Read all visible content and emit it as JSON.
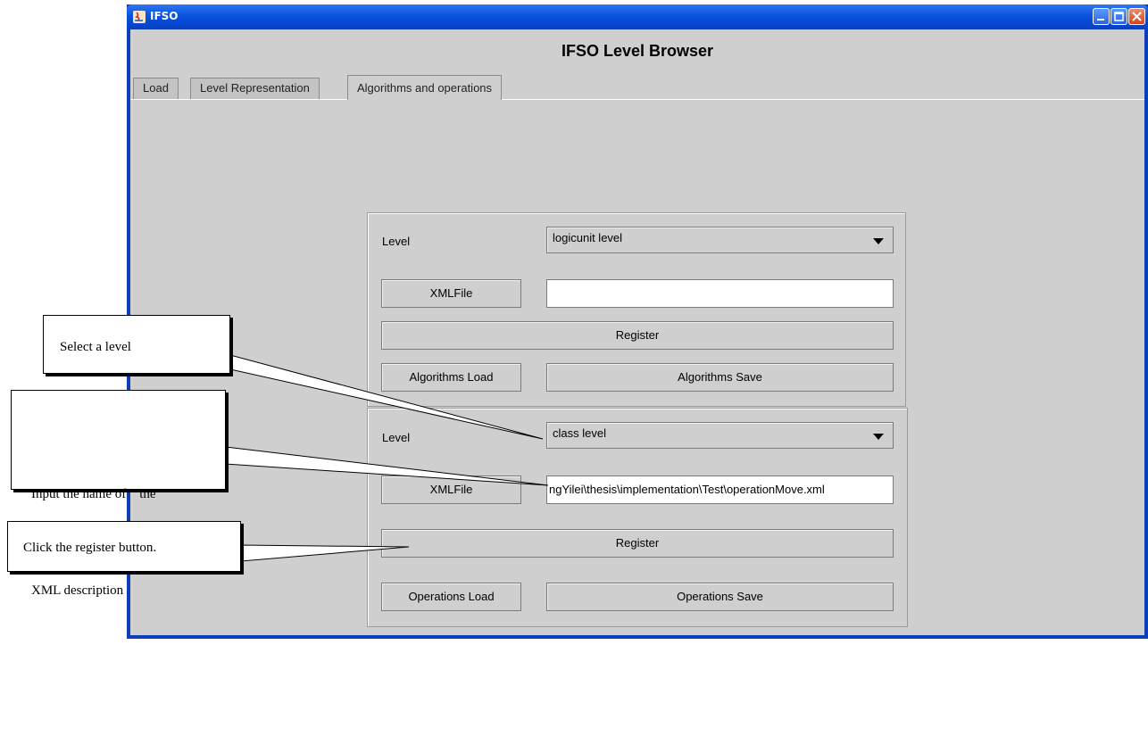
{
  "window": {
    "title": "IFSO"
  },
  "app": {
    "heading": "IFSO Level Browser"
  },
  "tabs": [
    {
      "label": "Load"
    },
    {
      "label": "Level Representation"
    },
    {
      "label": "Algorithms and operations"
    }
  ],
  "algorithms_panel": {
    "level_label": "Level",
    "level_value": "logicunit level",
    "xmlfile_button": "XMLFile",
    "xmlfile_value": "",
    "register_button": "Register",
    "load_button": "Algorithms Load",
    "save_button": "Algorithms Save"
  },
  "operations_panel": {
    "level_label": "Level",
    "level_value": "class level",
    "xmlfile_button": "XMLFile",
    "xmlfile_value": "ngYilei\\thesis\\implementation\\Test\\operationMove.xml",
    "register_button": "Register",
    "load_button": "Operations Load",
    "save_button": "Operations Save"
  },
  "annotations": {
    "select_level": "Select a level",
    "input_name_line1": "Input the name of    the",
    "input_name_line2": "XML description",
    "click_register": "Click the register button."
  },
  "colors": {
    "titlebar": "#0a52dc",
    "client": "#cfcfcf"
  }
}
